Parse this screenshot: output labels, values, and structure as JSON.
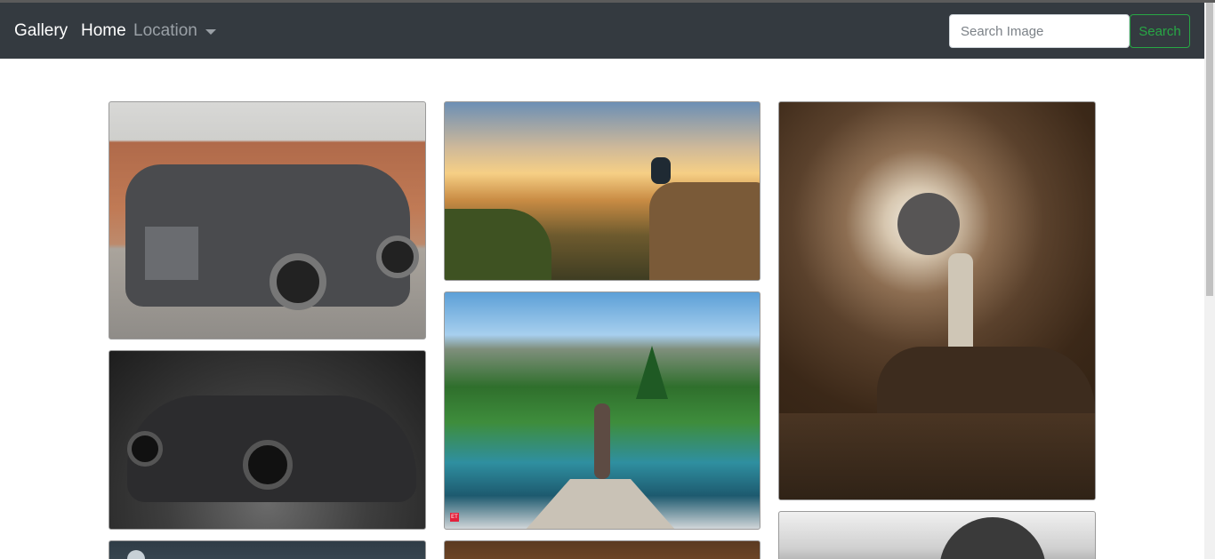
{
  "navbar": {
    "brand": "Gallery",
    "home_label": "Home",
    "location_label": "Location",
    "search": {
      "placeholder": "Search Image",
      "value": ""
    },
    "search_button_label": "Search",
    "colors": {
      "background": "#343a40",
      "search_accent": "#28a745"
    }
  },
  "gallery": {
    "images": [
      {
        "subject": "Grey luxury SUV parked in front of a brick wall"
      },
      {
        "subject": "Black luxury coupe in a dark studio"
      },
      {
        "subject": "Person sitting on a cliff edge at sunset"
      },
      {
        "subject": "Person with raised arms on a wooden dock facing a lake and mountains",
        "badge": "ET"
      },
      {
        "subject": "Man standing on an old rusty car beneath a swirling sky with a moon"
      },
      {
        "subject": "Night sky image, partially visible"
      },
      {
        "subject": "Brown-toned image, partially visible"
      },
      {
        "subject": "Black and white image, partially visible"
      }
    ]
  }
}
